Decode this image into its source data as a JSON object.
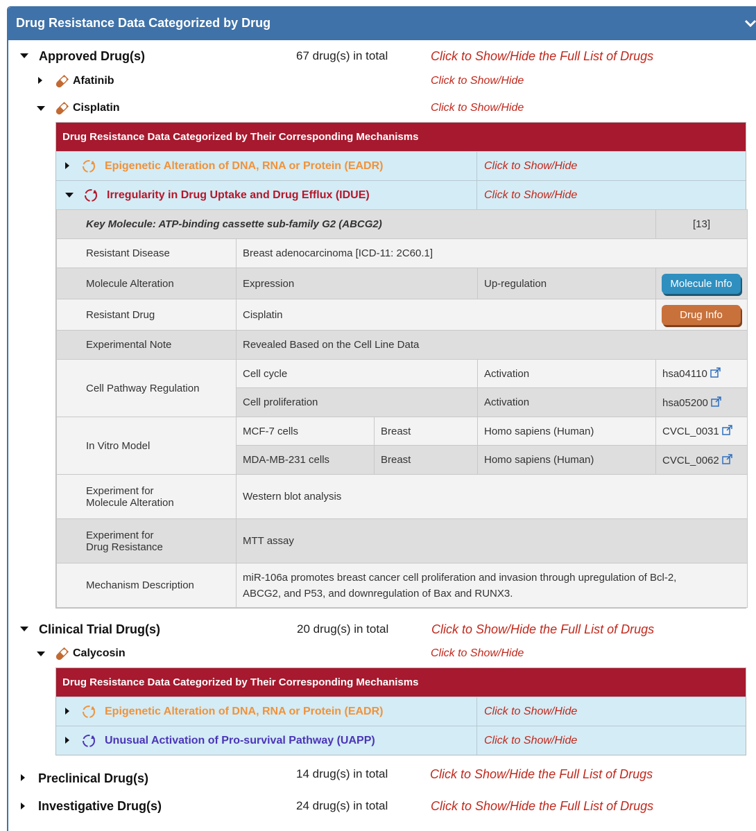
{
  "panel": {
    "title": "Drug Resistance Data Categorized by Drug"
  },
  "colors": {
    "panel_blue": "#3f72a8",
    "mech_red": "#a6192e",
    "link_red": "#c0281c",
    "row_blue": "#d4ecf5",
    "eadr_orange": "#f0923a",
    "idue_red": "#b5162a",
    "uapp_purple": "#4a35b8"
  },
  "approved": {
    "label": "Approved Drug(s)",
    "count": "67 drug(s) in total",
    "toggle": "Click to Show/Hide the Full List of Drugs",
    "drugs": [
      {
        "name": "Afatinib",
        "toggle": "Click to Show/Hide"
      },
      {
        "name": "Cisplatin",
        "toggle": "Click to Show/Hide"
      }
    ]
  },
  "cisplatin_mech": {
    "header": "Drug Resistance Data Categorized by Their Corresponding Mechanisms",
    "rows": [
      {
        "title": "Epigenetic Alteration of DNA, RNA or Protein (EADR)",
        "toggle": "Click to Show/Hide"
      },
      {
        "title": "Irregularity in Drug Uptake and Drug Efflux (IDUE)",
        "toggle": "Click to Show/Hide"
      }
    ],
    "detail": {
      "key_molecule": "Key Molecule: ATP-binding cassette sub-family G2 (ABCG2)",
      "ref": "[13]",
      "resistant_disease_label": "Resistant Disease",
      "resistant_disease": "Breast adenocarcinoma [ICD-11: 2C60.1]",
      "molecule_alteration_label": "Molecule Alteration",
      "alteration_type": "Expression",
      "alteration_value": "Up-regulation",
      "molecule_info_btn": "Molecule Info",
      "resistant_drug_label": "Resistant Drug",
      "resistant_drug": "Cisplatin",
      "drug_info_btn": "Drug Info",
      "experimental_note_label": "Experimental Note",
      "experimental_note": "Revealed Based on the Cell Line Data",
      "pathway_label": "Cell Pathway Regulation",
      "pathways": [
        {
          "name": "Cell cycle",
          "effect": "Activation",
          "id": "hsa04110"
        },
        {
          "name": "Cell proliferation",
          "effect": "Activation",
          "id": "hsa05200"
        }
      ],
      "invitro_label": "In Vitro Model",
      "models": [
        {
          "cell": "MCF-7 cells",
          "tissue": "Breast",
          "species": "Homo sapiens (Human)",
          "id": "CVCL_0031"
        },
        {
          "cell": "MDA-MB-231 cells",
          "tissue": "Breast",
          "species": "Homo sapiens (Human)",
          "id": "CVCL_0062"
        }
      ],
      "exp_mol_label_1": "Experiment for",
      "exp_mol_label_2": "Molecule Alteration",
      "exp_mol": "Western blot analysis",
      "exp_drug_label_1": "Experiment for",
      "exp_drug_label_2": "Drug Resistance",
      "exp_drug": "MTT assay",
      "mech_desc_label": "Mechanism Description",
      "mech_desc_1": "miR-106a promotes breast cancer cell proliferation and invasion through upregulation of Bcl-2,",
      "mech_desc_2": "ABCG2, and P53, and downregulation of Bax and RUNX3."
    }
  },
  "clinical": {
    "label": "Clinical Trial Drug(s)",
    "count": "20 drug(s) in total",
    "toggle": "Click to Show/Hide the Full List of Drugs",
    "drugs": [
      {
        "name": "Calycosin",
        "toggle": "Click to Show/Hide"
      }
    ]
  },
  "calycosin_mech": {
    "header": "Drug Resistance Data Categorized by Their Corresponding Mechanisms",
    "rows": [
      {
        "title": "Epigenetic Alteration of DNA, RNA or Protein (EADR)",
        "toggle": "Click to Show/Hide"
      },
      {
        "title": "Unusual Activation of Pro-survival Pathway (UAPP)",
        "toggle": "Click to Show/Hide"
      }
    ]
  },
  "preclinical": {
    "label": "Preclinical Drug(s)",
    "count": "14 drug(s) in total",
    "toggle": "Click to Show/Hide the Full List of Drugs"
  },
  "investigative": {
    "label": "Investigative Drug(s)",
    "count": "24 drug(s) in total",
    "toggle": "Click to Show/Hide the Full List of Drugs"
  }
}
